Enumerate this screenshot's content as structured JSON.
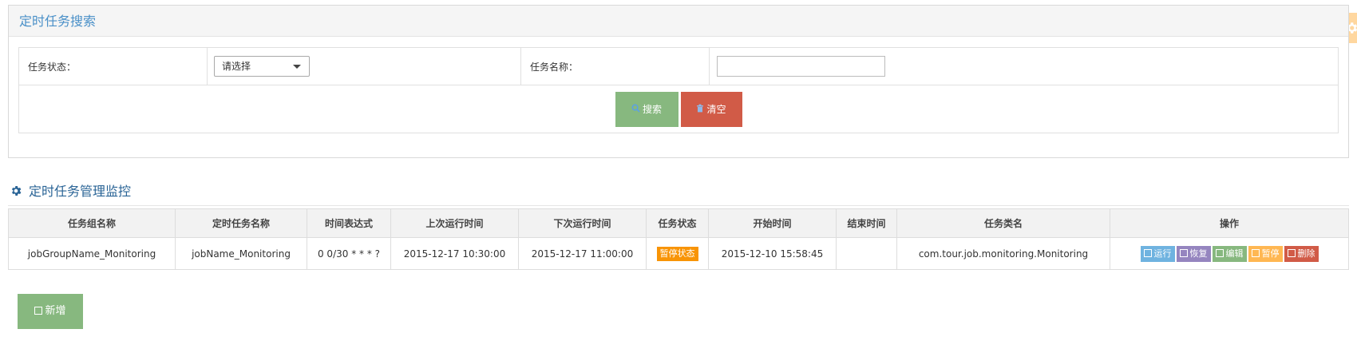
{
  "search_panel": {
    "title": "定时任务搜索",
    "status_label": "任务状态：",
    "status_select": {
      "selected": "请选择"
    },
    "name_label": "任务名称：",
    "name_input": {
      "value": "",
      "placeholder": ""
    },
    "search_button": "搜索",
    "clear_button": "清空"
  },
  "monitor": {
    "title": "定时任务管理监控",
    "columns": [
      "任务组名称",
      "定时任务名称",
      "时间表达式",
      "上次运行时间",
      "下次运行时间",
      "任务状态",
      "开始时间",
      "结束时间",
      "任务类名",
      "操作"
    ],
    "rows": [
      {
        "group": "jobGroupName_Monitoring",
        "name": "jobName_Monitoring",
        "cron": "0 0/30 * * * ?",
        "last_run": "2015-12-17 10:30:00",
        "next_run": "2015-12-17 11:00:00",
        "status": "暂停状态",
        "start": "2015-12-10 15:58:45",
        "end": "",
        "class_name": "com.tour.job.monitoring.Monitoring",
        "actions": {
          "run": "运行",
          "resume": "恢复",
          "edit": "编辑",
          "pause": "暂停",
          "delete": "删除"
        }
      }
    ]
  },
  "add_button": "新增",
  "colors": {
    "header_blue": "#4a90c8",
    "green": "#87b87f",
    "red": "#d15b47",
    "orange": "#f89406",
    "purple": "#9585bf",
    "light_blue": "#6fb3e0",
    "yellow": "#ffb752"
  }
}
